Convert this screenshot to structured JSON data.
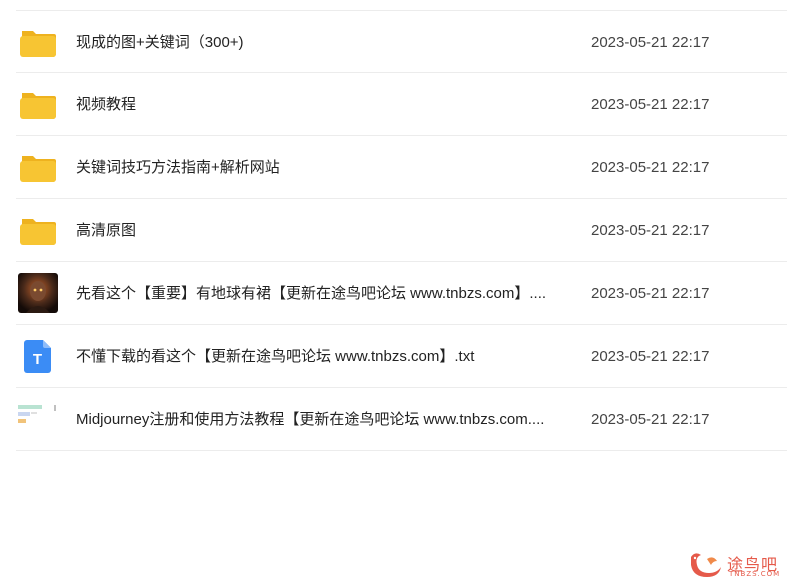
{
  "files": [
    {
      "name": "现成的图+关键词（300+)",
      "date": "2023-05-21 22:17",
      "icon": "folder-icon"
    },
    {
      "name": "视频教程",
      "date": "2023-05-21 22:17",
      "icon": "folder-icon"
    },
    {
      "name": "关键词技巧方法指南+解析网站",
      "date": "2023-05-21 22:17",
      "icon": "folder-icon"
    },
    {
      "name": "高清原图",
      "date": "2023-05-21 22:17",
      "icon": "folder-icon"
    },
    {
      "name": "先看这个【重要】有地球有裙【更新在途鸟吧论坛 www.tnbzs.com】....",
      "date": "2023-05-21 22:17",
      "icon": "image-thumbnail"
    },
    {
      "name": "不懂下载的看这个【更新在途鸟吧论坛 www.tnbzs.com】.txt",
      "date": "2023-05-21 22:17",
      "icon": "text-file-icon"
    },
    {
      "name": "Midjourney注册和使用方法教程【更新在途鸟吧论坛 www.tnbzs.com....",
      "date": "2023-05-21 22:17",
      "icon": "document-thumbnail"
    }
  ],
  "watermark": {
    "text": "途鸟吧",
    "sub": "TNBZS.COM"
  },
  "colors": {
    "folder": "#f7c533",
    "folder_tab": "#eeb21f",
    "txt": "#3b8cf5",
    "divider": "#ececec",
    "watermark": "#e55a4a"
  }
}
